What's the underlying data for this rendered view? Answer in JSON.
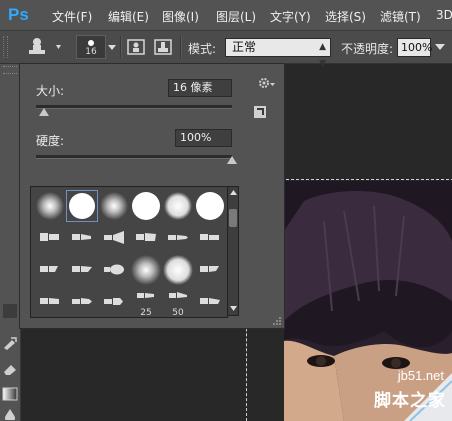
{
  "app": {
    "logo_text": "Ps"
  },
  "menubar": {
    "items": [
      "文件(F)",
      "编辑(E)",
      "图像(I)",
      "图层(L)",
      "文字(Y)",
      "选择(S)",
      "滤镜(T)",
      "3D"
    ]
  },
  "options_bar": {
    "brush_size": "16",
    "mode_label": "模式:",
    "mode_value": "正常",
    "opacity_label": "不透明度:",
    "opacity_value": "100%"
  },
  "brush_panel": {
    "size_label": "大小:",
    "size_value": "16 像素",
    "size_slider_fraction": 0.04,
    "hardness_label": "硬度:",
    "hardness_value": "100%",
    "hardness_slider_fraction": 1.0,
    "gear_icon": "gear-icon",
    "brush_numbers": [
      "25",
      "50"
    ]
  },
  "watermark": {
    "site": "jb51.net",
    "name": "脚本之家"
  },
  "colors": {
    "panel_bg": "#535353",
    "menubar_bg": "#535353",
    "canvas_bg": "#282828",
    "selection_outline": "#6f8fc8",
    "logo": "#31a8ff"
  }
}
